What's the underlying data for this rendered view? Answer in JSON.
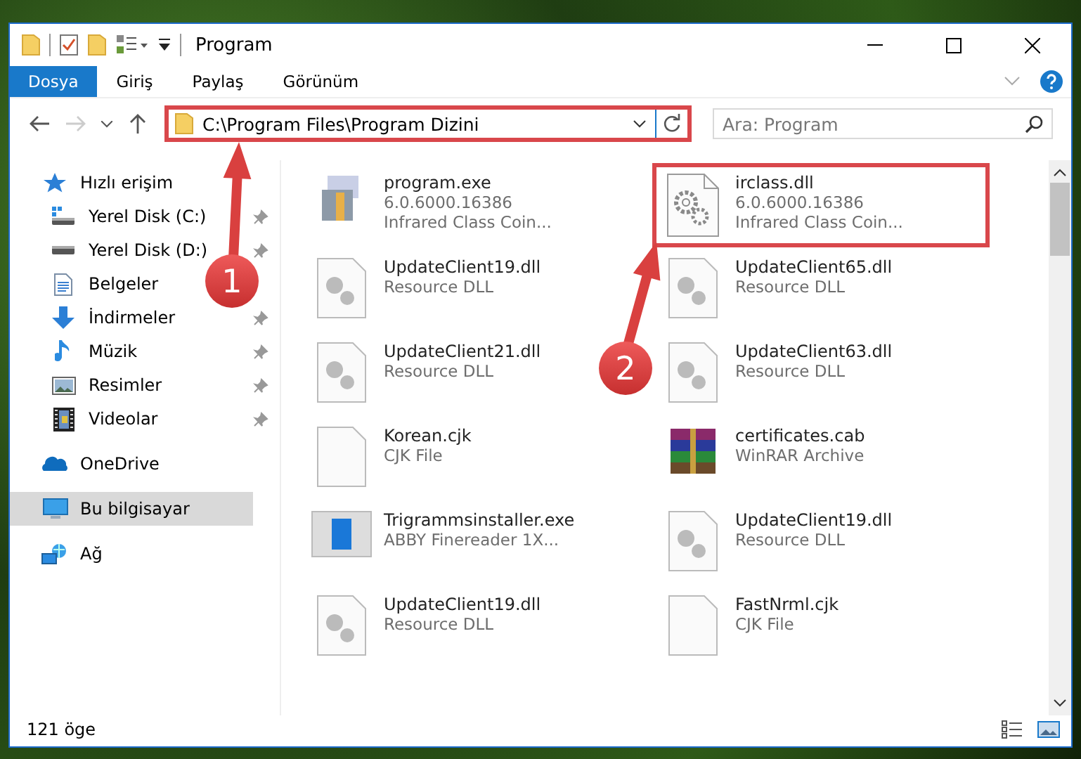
{
  "window": {
    "title": "Program"
  },
  "ribbon_tabs": [
    {
      "label": "Dosya",
      "selected": true
    },
    {
      "label": "Giriş",
      "selected": false
    },
    {
      "label": "Paylaş",
      "selected": false
    },
    {
      "label": "Görünüm",
      "selected": false
    }
  ],
  "address_bar": {
    "value": "C:\\Program Files\\Program Dizini",
    "highlighted": true
  },
  "search": {
    "placeholder": "Ara: Program"
  },
  "sidebar": {
    "items": [
      {
        "kind": "star",
        "label": "Hızlı erişim",
        "pinned": false,
        "selected": false,
        "group": true
      },
      {
        "kind": "drive-c",
        "label": "Yerel Disk (C:)",
        "pinned": true,
        "selected": false,
        "group": false
      },
      {
        "kind": "drive",
        "label": "Yerel Disk (D:)",
        "pinned": true,
        "selected": false,
        "group": false
      },
      {
        "kind": "document",
        "label": "Belgeler",
        "pinned": false,
        "selected": false,
        "group": false
      },
      {
        "kind": "download",
        "label": "İndirmeler",
        "pinned": true,
        "selected": false,
        "group": false
      },
      {
        "kind": "music",
        "label": "Müzik",
        "pinned": true,
        "selected": false,
        "group": false
      },
      {
        "kind": "picture",
        "label": "Resimler",
        "pinned": true,
        "selected": false,
        "group": false
      },
      {
        "kind": "video",
        "label": "Videolar",
        "pinned": true,
        "selected": false,
        "group": false
      },
      {
        "kind": "cloud",
        "label": "OneDrive",
        "pinned": false,
        "selected": false,
        "group": true
      },
      {
        "kind": "computer",
        "label": "Bu bilgisayar",
        "pinned": false,
        "selected": true,
        "group": true
      },
      {
        "kind": "network",
        "label": "Ağ",
        "pinned": false,
        "selected": false,
        "group": true
      }
    ]
  },
  "files": [
    {
      "kind": "program",
      "name": "program.exe",
      "details": [
        "6.0.6000.16386",
        "Infrared Class Coin..."
      ],
      "highlighted": false
    },
    {
      "kind": "settings",
      "name": "irclass.dll",
      "details": [
        "6.0.6000.16386",
        "Infrared Class Coin..."
      ],
      "highlighted": true
    },
    {
      "kind": "dll",
      "name": "UpdateClient19.dll",
      "details": [
        "Resource DLL"
      ],
      "highlighted": false
    },
    {
      "kind": "dll",
      "name": "UpdateClient65.dll",
      "details": [
        "Resource DLL"
      ],
      "highlighted": false
    },
    {
      "kind": "dll",
      "name": "UpdateClient21.dll",
      "details": [
        "Resource DLL"
      ],
      "highlighted": false
    },
    {
      "kind": "dll",
      "name": "UpdateClient63.dll",
      "details": [
        "Resource DLL"
      ],
      "highlighted": false
    },
    {
      "kind": "blank",
      "name": "Korean.cjk",
      "details": [
        "CJK File"
      ],
      "highlighted": false
    },
    {
      "kind": "archive",
      "name": "certificates.cab",
      "details": [
        "WinRAR Archive"
      ],
      "highlighted": false
    },
    {
      "kind": "installer",
      "name": "Trigrammsinstaller.exe",
      "details": [
        "ABBY Finereader 1X..."
      ],
      "highlighted": false
    },
    {
      "kind": "dll",
      "name": "UpdateClient19.dll",
      "details": [
        "Resource DLL"
      ],
      "highlighted": false
    },
    {
      "kind": "dll",
      "name": "UpdateClient19.dll",
      "details": [
        "Resource DLL"
      ],
      "highlighted": false
    },
    {
      "kind": "blank",
      "name": "FastNrml.cjk",
      "details": [
        "CJK File"
      ],
      "highlighted": false
    }
  ],
  "status_bar": {
    "item_count": "121 öge"
  },
  "annotations": [
    {
      "label": "1"
    },
    {
      "label": "2"
    }
  ]
}
